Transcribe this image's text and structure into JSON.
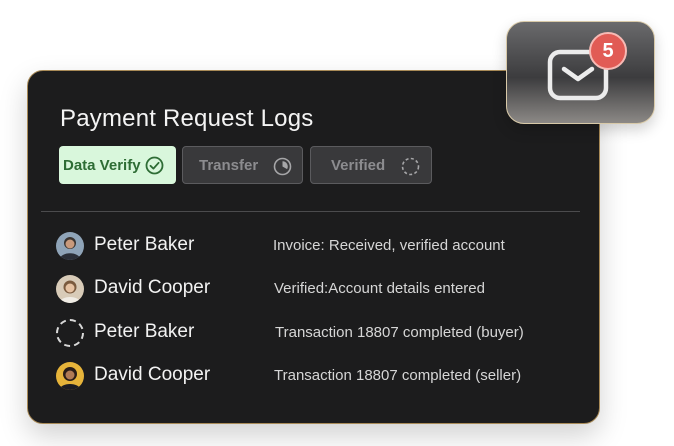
{
  "panel": {
    "title": "Payment Request Logs",
    "tabs": [
      {
        "label": "Data Verify",
        "state": "done",
        "icon": "check-circle-icon"
      },
      {
        "label": "Transfer",
        "state": "in-progress",
        "icon": "progress-circle-icon"
      },
      {
        "label": "Verified",
        "state": "pending",
        "icon": "dashed-circle-icon"
      }
    ]
  },
  "logs": [
    {
      "name": "Peter Baker",
      "event": "Invoice: Received, verified account"
    },
    {
      "name": "David Cooper",
      "event": "Verified:Account details entered"
    },
    {
      "name": "Peter Baker",
      "event": "Transaction 18807 completed (buyer)"
    },
    {
      "name": "David Cooper",
      "event": "Transaction 18807 completed (seller)"
    }
  ],
  "notifications": {
    "count": "5",
    "icon": "mail-icon"
  },
  "colors": {
    "card_bg": "#1c1c1d",
    "accent_green": "#2e6d35",
    "green_tab_bg": "#d9f7dc",
    "badge_red": "#e15b55",
    "card_border": "#a88a57"
  }
}
